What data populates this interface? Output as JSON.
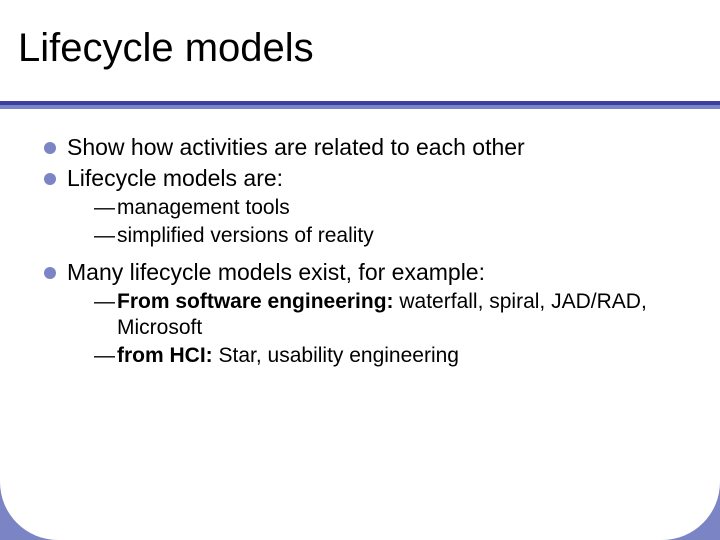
{
  "title": "Lifecycle models",
  "bullets": {
    "b0": "Show how activities are related to each other",
    "b1": "Lifecycle models are:",
    "b2": "Many lifecycle models exist, for example:"
  },
  "sub1": {
    "s0": "management tools",
    "s1": "simplified versions of reality"
  },
  "sub2": {
    "s0_prefix": "From software engineering:",
    "s0_rest": " waterfall, spiral, JAD/RAD, Microsoft",
    "s1_prefix": "from HCI:",
    "s1_rest": " Star, usability engineering"
  }
}
